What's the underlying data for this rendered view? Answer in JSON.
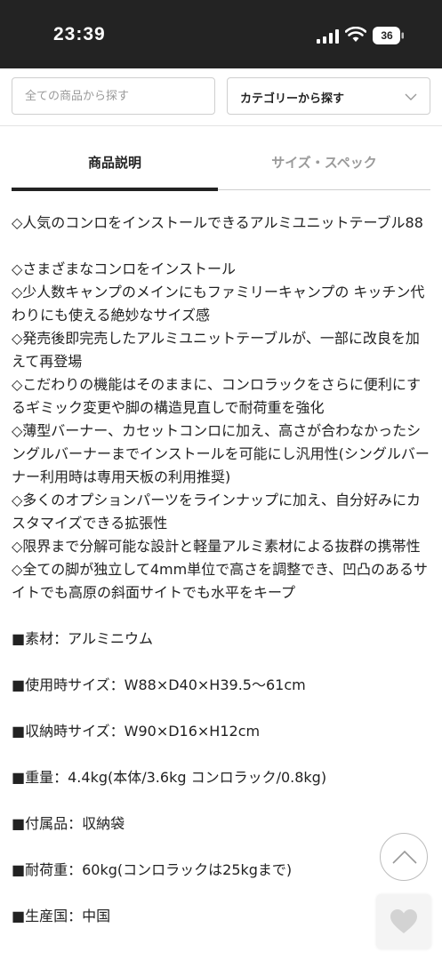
{
  "status_bar": {
    "time": "23:39",
    "battery": "36"
  },
  "header": {
    "search_placeholder": "全ての商品から探す",
    "category_label": "カテゴリーから探す"
  },
  "tabs": [
    {
      "label": "商品説明",
      "active": true
    },
    {
      "label": "サイズ・スペック",
      "active": false
    }
  ],
  "description": {
    "lines": [
      "◇人気のコンロをインストールできるアルミユニットテーブル88",
      "",
      "◇さまざまなコンロをインストール",
      "◇少人数キャンプのメインにもファミリーキャンプの キッチン代わりにも使える絶妙なサイズ感",
      "◇発売後即完売したアルミユニットテーブルが、一部に改良を加えて再登場",
      "◇こだわりの機能はそのままに、コンロラックをさらに便利にするギミック変更や脚の構造見直しで耐荷重を強化",
      "◇薄型バーナー、カセットコンロに加え、高さが合わなかったシングルバーナーまでインストールを可能にし汎用性(シングルバーナー利用時は専用天板の利用推奨)",
      "◇多くのオプションパーツをラインナップに加え、自分好みにカスタマイズできる拡張性",
      "◇限界まで分解可能な設計と軽量アルミ素材による抜群の携帯性",
      "◇全ての脚が独立して4mm単位で高さを調整でき、凹凸のあるサイトでも高原の斜面サイトでも水平をキープ",
      "",
      "■素材：アルミニウム",
      "",
      "■使用時サイズ：W88×D40×H39.5〜61cm",
      "",
      "■収納時サイズ：W90×D16×H12cm",
      "",
      "■重量：4.4kg(本体/3.6kg コンロラック/0.8kg)",
      "",
      "■付属品：収納袋",
      "",
      "■耐荷重：60kg(コンロラックは25kgまで)",
      "",
      "■生産国：中国"
    ]
  },
  "icons": {
    "scroll_top": "chevron-up-icon",
    "favorite": "heart-icon"
  }
}
